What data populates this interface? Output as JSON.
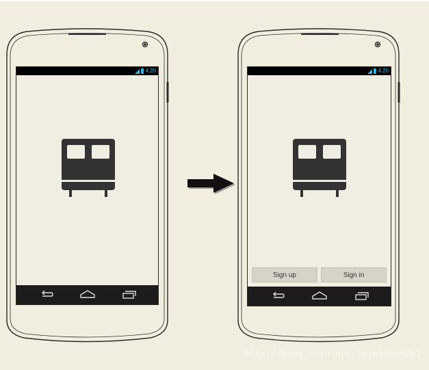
{
  "left_phone": {
    "status": {
      "time": "4:20"
    },
    "screen_name": "splash"
  },
  "right_phone": {
    "status": {
      "time": "4:20"
    },
    "buttons": {
      "sign_up": "Sign up",
      "sign_in": "Sign in"
    }
  },
  "icons": {
    "app": "bus-icon",
    "nav_back": "back-icon",
    "nav_home": "home-icon",
    "nav_recents": "recent-apps-icon",
    "transition": "arrow-right-icon"
  },
  "colors": {
    "background": "#f1eee0",
    "screen": "#f0eee2",
    "status_accent": "#33b5e5",
    "icon": "#333333",
    "navbar": "#1c1c1c"
  },
  "watermark": "http://blog.csdn.net/lmj623565791"
}
